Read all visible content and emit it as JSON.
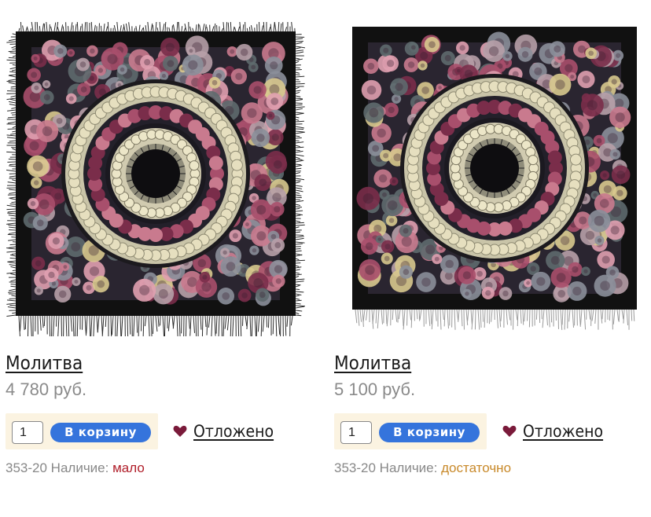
{
  "products": [
    {
      "title": "Молитва",
      "price": "4 780 руб.",
      "quantity": "1",
      "cart_button": "В корзину",
      "wishlist_label": "Отложено",
      "sku": "353-20",
      "availability_label": "Наличие:",
      "availability_value": "мало",
      "availability_color": "#b01e2a"
    },
    {
      "title": "Молитва",
      "price": "5 100 руб.",
      "quantity": "1",
      "cart_button": "В корзину",
      "wishlist_label": "Отложено",
      "sku": "353-20",
      "availability_label": "Наличие:",
      "availability_value": "достаточно",
      "availability_color": "#c8892a"
    }
  ],
  "colors": {
    "button": "#3574dc",
    "buy_box_bg": "#fbf3e1",
    "heart": "#7a1a3a"
  }
}
